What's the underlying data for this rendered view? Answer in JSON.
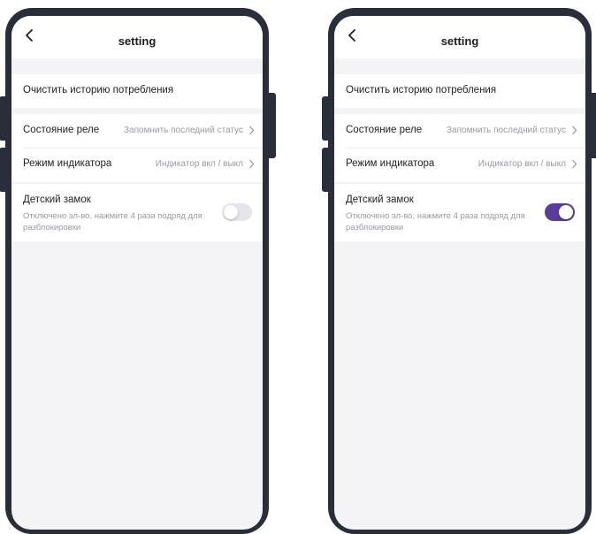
{
  "header": {
    "title": "setting"
  },
  "menu": {
    "clear_history": "Очистить историю потребления",
    "relay_state": {
      "label": "Состояние реле",
      "value": "Запомнить последний статус"
    },
    "indicator_mode": {
      "label": "Режим индикатора",
      "value": "Индикатор вкл / выкл"
    },
    "child_lock": {
      "label": "Детский замок",
      "description": "Отключено эл-во, нажмите 4 раза подряд для разблокировки"
    }
  },
  "phones": [
    {
      "child_lock_on": false
    },
    {
      "child_lock_on": true
    }
  ],
  "colors": {
    "frame": "#2a2d3a",
    "toggle_on": "#5a3d9a",
    "toggle_off": "#e6e6ea",
    "screen_bg": "#f4f4f6"
  },
  "icons": [
    "back-chevron-icon",
    "chevron-right-icon"
  ]
}
